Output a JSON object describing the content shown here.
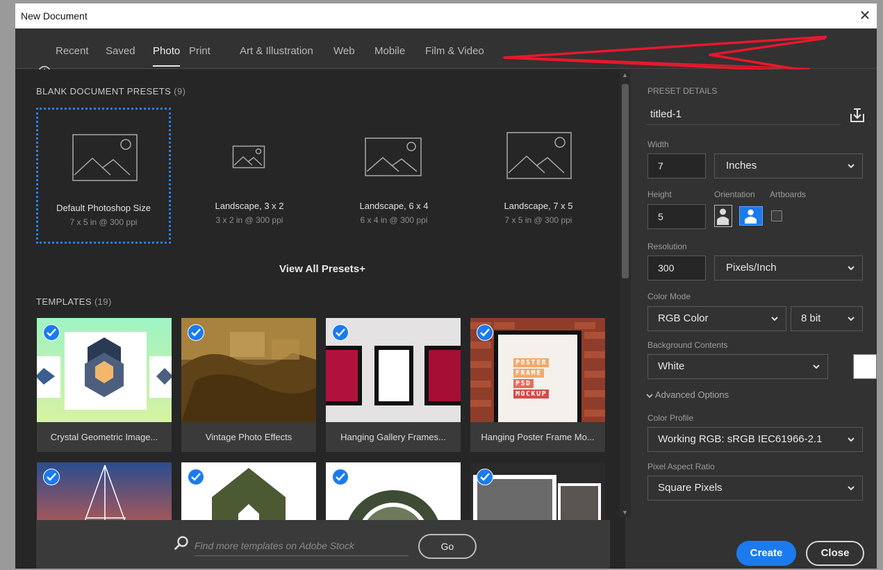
{
  "window": {
    "title": "New Document",
    "close_glyph": "✕"
  },
  "tabs": [
    {
      "label": "Recent",
      "icon": "clock-icon"
    },
    {
      "label": "Saved"
    },
    {
      "label": "Photo",
      "active": true
    },
    {
      "label": "Print"
    },
    {
      "label": "Art & Illustration"
    },
    {
      "label": "Web"
    },
    {
      "label": "Mobile"
    },
    {
      "label": "Film & Video"
    }
  ],
  "presets_section": {
    "title": "BLANK DOCUMENT PRESETS",
    "count": "(9)"
  },
  "presets": [
    {
      "name": "Default Photoshop Size",
      "spec": "7 x 5 in @ 300 ppi",
      "selected": true
    },
    {
      "name": "Landscape, 3 x 2",
      "spec": "3 x 2 in @ 300 ppi"
    },
    {
      "name": "Landscape, 6 x 4",
      "spec": "6 x 4 in @ 300 ppi"
    },
    {
      "name": "Landscape, 7 x 5",
      "spec": "7 x 5 in @ 300 ppi"
    }
  ],
  "view_all_presets": "View All Presets+",
  "templates_section": {
    "title": "TEMPLATES",
    "count": "(19)"
  },
  "templates": [
    {
      "caption": "Crystal Geometric Image..."
    },
    {
      "caption": "Vintage Photo Effects"
    },
    {
      "caption": "Hanging Gallery Frames..."
    },
    {
      "caption": "Hanging Poster Frame Mo..."
    }
  ],
  "poster_words": [
    "POSTER",
    "FRAME",
    "PSD",
    "MOCKUP"
  ],
  "stock_search": {
    "placeholder": "Find more templates on Adobe Stock",
    "go_label": "Go"
  },
  "preset_details": {
    "heading": "PRESET DETAILS",
    "doc_name": "titled-1",
    "width_label": "Width",
    "width_value": "7",
    "units": "Inches",
    "height_label": "Height",
    "height_value": "5",
    "orientation_label": "Orientation",
    "artboards_label": "Artboards",
    "artboards_checked": false,
    "orientation": "landscape",
    "resolution_label": "Resolution",
    "resolution_value": "300",
    "resolution_units": "Pixels/Inch",
    "color_mode_label": "Color Mode",
    "color_mode": "RGB Color",
    "bit_depth": "8 bit",
    "background_label": "Background Contents",
    "background": "White",
    "background_swatch": "#ffffff",
    "advanced_label": "Advanced Options",
    "color_profile_label": "Color Profile",
    "color_profile": "Working RGB: sRGB IEC61966-2.1",
    "pixel_aspect_label": "Pixel Aspect Ratio",
    "pixel_aspect": "Square Pixels"
  },
  "actions": {
    "create": "Create",
    "close": "Close"
  },
  "colors": {
    "accent": "#1b7bee",
    "annotation_arrow": "#e8182b"
  }
}
